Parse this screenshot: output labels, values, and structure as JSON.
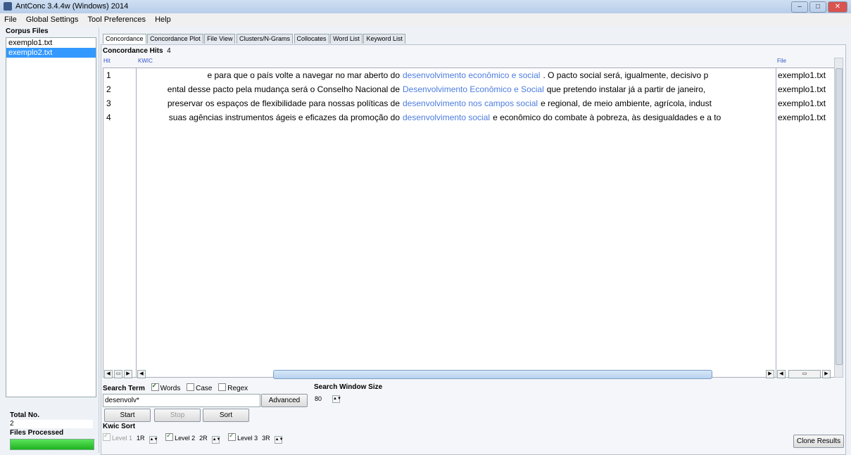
{
  "window": {
    "title": "AntConc 3.4.4w (Windows) 2014",
    "minimize": "–",
    "maximize": "□",
    "close": "✕"
  },
  "menu": [
    "File",
    "Global Settings",
    "Tool Preferences",
    "Help"
  ],
  "corpus": {
    "title": "Corpus Files",
    "files": [
      "exemplo1.txt",
      "exemplo2.txt"
    ],
    "total_label": "Total No.",
    "total_value": "2",
    "processed_label": "Files Processed",
    "progress": 1.0
  },
  "tabs": [
    "Concordance",
    "Concordance Plot",
    "File View",
    "Clusters/N-Grams",
    "Collocates",
    "Word List",
    "Keyword List"
  ],
  "concordance": {
    "hits_label": "Concordance Hits",
    "hits_count": "4",
    "col_hit": "Hit",
    "col_kwic": "KWIC",
    "col_file": "File",
    "rows": [
      {
        "hit": "1",
        "left": "e para que o país volte a navegar no mar aberto do",
        "key": "desenvolvimento econômico e social",
        "right": ". O pacto social será, igualmente, decisivo p",
        "file": "exemplo1.txt"
      },
      {
        "hit": "2",
        "left": "ental desse pacto pela mudança será o Conselho Nacional de",
        "key": "Desenvolvimento Econômico e Social",
        "right": "que pretendo instalar já a partir de janeiro,",
        "file": "exemplo1.txt"
      },
      {
        "hit": "3",
        "left": "preservar os espaços de flexibilidade para nossas políticas de",
        "key": "desenvolvimento nos campos social",
        "right": "e regional, de meio ambiente, agrícola, indust",
        "file": "exemplo1.txt"
      },
      {
        "hit": "4",
        "left": "suas agências instrumentos ágeis e eficazes da promoção do",
        "key": "desenvolvimento social",
        "right": "e econômico do combate à pobreza, às desigualdades e a to",
        "file": "exemplo1.txt"
      }
    ]
  },
  "search": {
    "label": "Search Term",
    "opt_words": "Words",
    "opt_case": "Case",
    "opt_regex": "Regex",
    "value": "desenvolv*",
    "advanced": "Advanced",
    "window_size_label": "Search Window Size",
    "window_size": "80",
    "start": "Start",
    "stop": "Stop",
    "sort": "Sort"
  },
  "kwic_sort": {
    "label": "Kwic Sort",
    "level1": "Level 1",
    "level1_val": "1R",
    "level2": "Level 2",
    "level2_val": "2R",
    "level3": "Level 3",
    "level3_val": "3R"
  },
  "clone": "Clone Results",
  "colors": {
    "keyword": "#4d7de0",
    "selected": "#3399ff",
    "progress": "#1fb31f"
  }
}
